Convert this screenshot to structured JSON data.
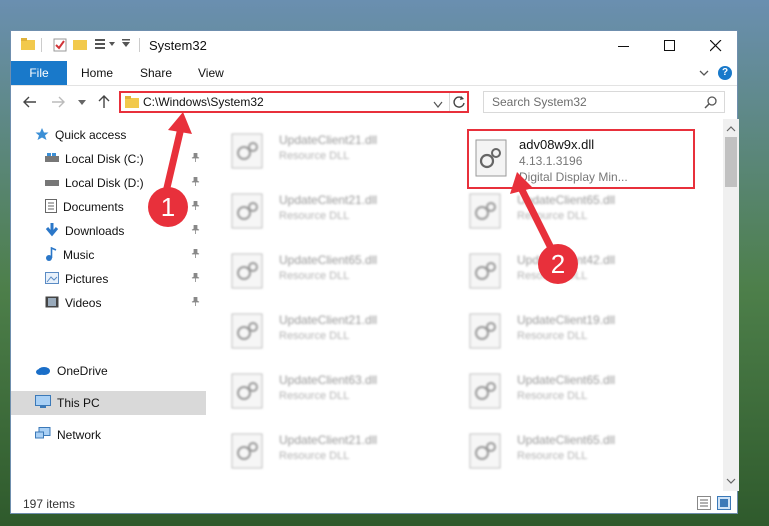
{
  "window": {
    "title": "System32"
  },
  "ribbon": {
    "file": "File",
    "home": "Home",
    "share": "Share",
    "view": "View",
    "help": "?"
  },
  "address": {
    "path": "C:\\Windows\\System32"
  },
  "search": {
    "placeholder": "Search System32"
  },
  "sidebar": {
    "items": [
      {
        "label": "Quick access",
        "icon": "star-icon"
      },
      {
        "label": "Local Disk (C:)",
        "icon": "drive-icon"
      },
      {
        "label": "Local Disk (D:)",
        "icon": "drive-icon"
      },
      {
        "label": "Documents",
        "icon": "documents-icon"
      },
      {
        "label": "Downloads",
        "icon": "download-icon"
      },
      {
        "label": "Music",
        "icon": "music-icon"
      },
      {
        "label": "Pictures",
        "icon": "pictures-icon"
      },
      {
        "label": "Videos",
        "icon": "videos-icon"
      },
      {
        "label": "OneDrive",
        "icon": "cloud-icon"
      },
      {
        "label": "This PC",
        "icon": "computer-icon"
      },
      {
        "label": "Network",
        "icon": "network-icon"
      }
    ]
  },
  "files": {
    "highlighted": {
      "name": "adv08w9x.dll",
      "version": "4.13.1.3196",
      "description": "Digital Display Min..."
    },
    "left_column": [
      {
        "name": "UpdateClient21.dll",
        "type": "Resource DLL"
      },
      {
        "name": "UpdateClient21.dll",
        "type": "Resource DLL"
      },
      {
        "name": "UpdateClient65.dll",
        "type": "Resource DLL"
      },
      {
        "name": "UpdateClient21.dll",
        "type": "Resource DLL"
      },
      {
        "name": "UpdateClient63.dll",
        "type": "Resource DLL"
      },
      {
        "name": "UpdateClient21.dll",
        "type": "Resource DLL"
      }
    ],
    "right_column": [
      {
        "name": "UpdateClient65.dll",
        "type": "Resource DLL"
      },
      {
        "name": "UpdateClient42.dll",
        "type": "Resource DLL"
      },
      {
        "name": "UpdateClient19.dll",
        "type": "Resource DLL"
      },
      {
        "name": "UpdateClient65.dll",
        "type": "Resource DLL"
      },
      {
        "name": "UpdateClient65.dll",
        "type": "Resource DLL"
      }
    ]
  },
  "status": {
    "count": "197 items"
  },
  "annotations": {
    "step1": "1",
    "step2": "2"
  },
  "colors": {
    "accent": "#1979ca",
    "highlight": "#e8303b"
  }
}
